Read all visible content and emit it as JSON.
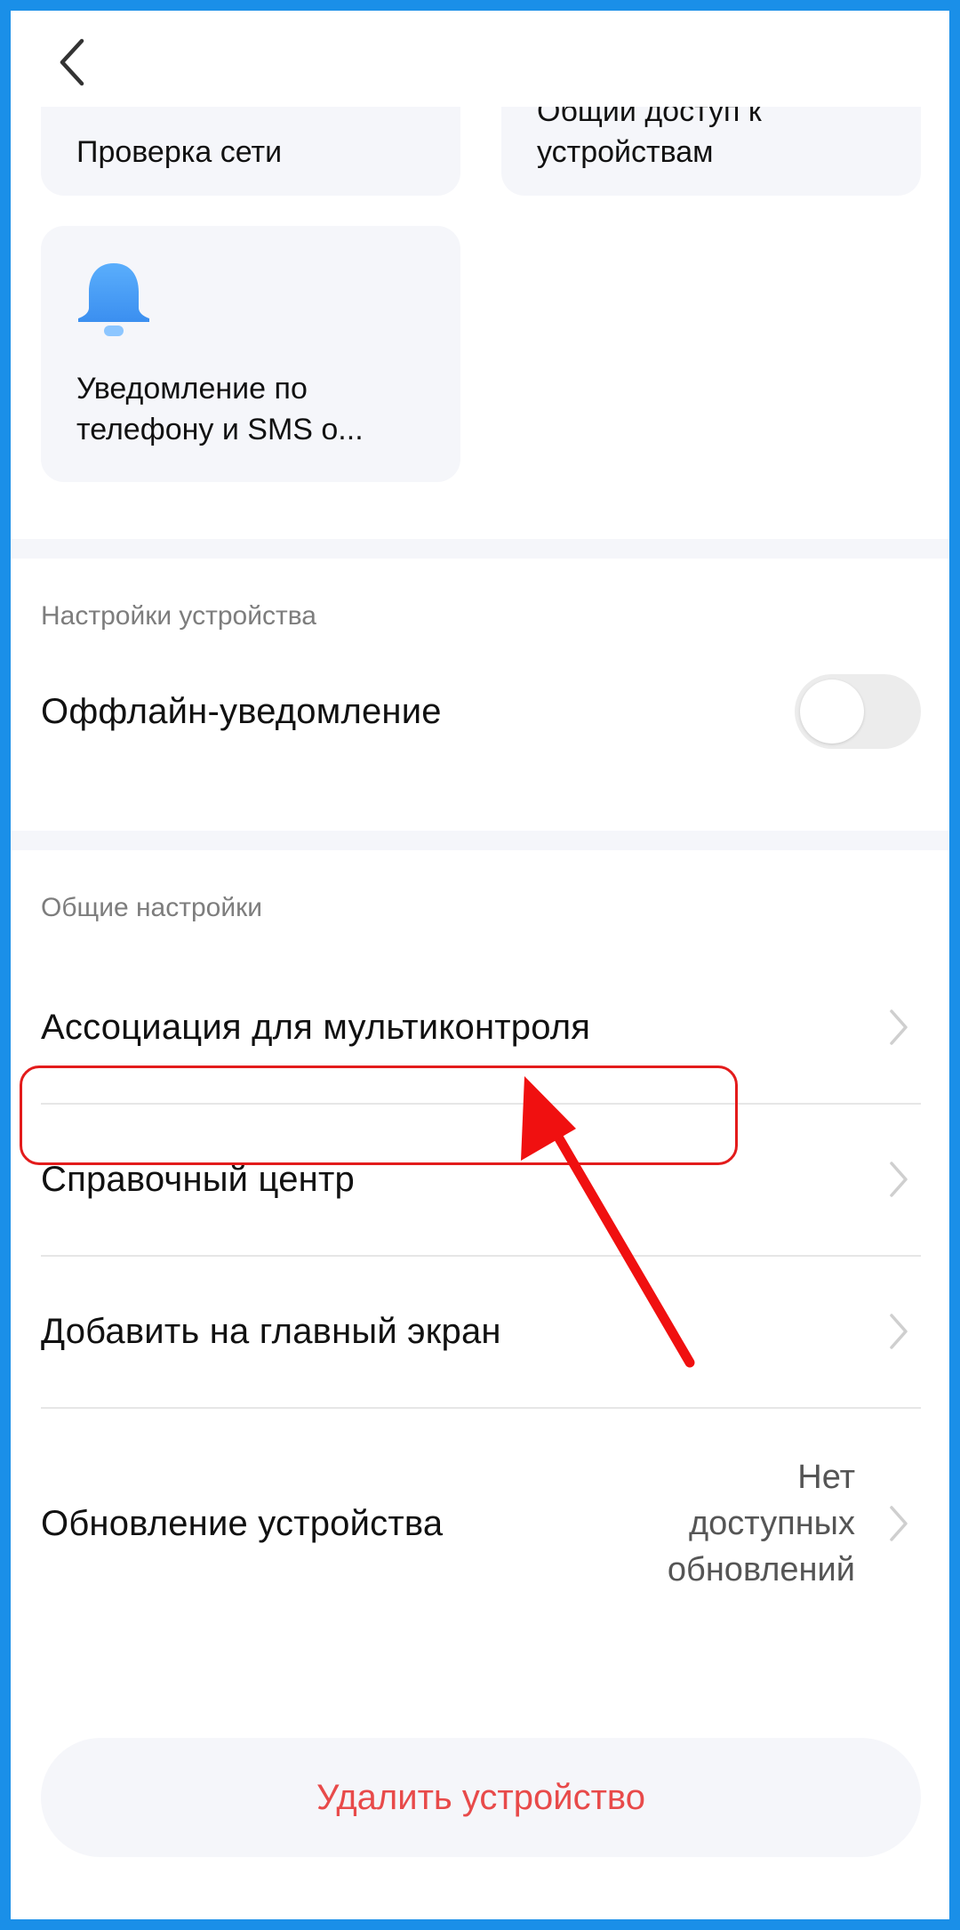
{
  "header": {
    "back_icon": "chevron-left-icon"
  },
  "cards": {
    "network_check": {
      "label": "Проверка сети"
    },
    "device_sharing": {
      "label_line1": "Общий доступ к",
      "label_line2": "устройствам"
    },
    "phone_sms": {
      "label_line1": "Уведомление по",
      "label_line2": "телефону и SMS о...",
      "icon": "bell-icon",
      "icon_color": "#4a9ff5"
    }
  },
  "device_settings": {
    "header": "Настройки устройства",
    "offline_notification": {
      "label": "Оффлайн-уведомление",
      "enabled": false
    }
  },
  "general_settings": {
    "header": "Общие настройки",
    "items": [
      {
        "label": "Ассоциация для мультиконтроля"
      },
      {
        "label": "Справочный центр"
      },
      {
        "label": "Добавить на главный экран"
      },
      {
        "label": "Обновление устройства",
        "value_line1": "Нет",
        "value_line2": "доступных",
        "value_line3": "обновлений"
      }
    ]
  },
  "delete_button": {
    "label": "Удалить устройство",
    "color": "#e84a4a"
  },
  "annotation": {
    "highlight_color": "#e31b1b",
    "frame_color": "#1a8fe8"
  }
}
